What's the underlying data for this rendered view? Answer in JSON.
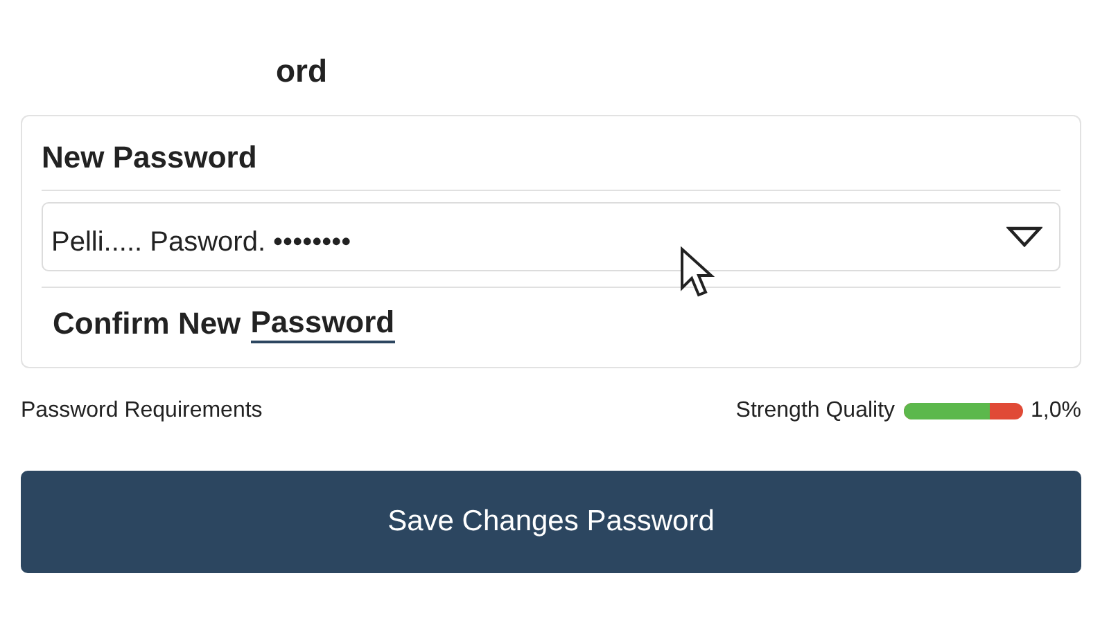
{
  "title": "ord",
  "new_password": {
    "label": "New Password",
    "value": "Pelli..... Pasword. ••••••••"
  },
  "confirm_password": {
    "label": "Confirm New",
    "link": "Password"
  },
  "requirements": "Password Requirements",
  "strength": {
    "label": "Strength Quality",
    "level": 0.73,
    "reading": "1,0%"
  },
  "save_button": "Save Changes Password"
}
